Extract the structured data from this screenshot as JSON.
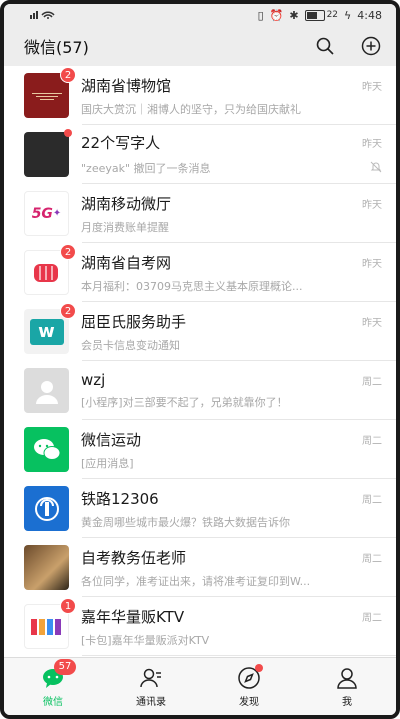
{
  "status_bar": {
    "left_icons": "4G ≋ ⎍",
    "time": "4:48",
    "battery": "22"
  },
  "header": {
    "title": "微信(57)"
  },
  "chats": [
    {
      "name": "湖南省博物馆",
      "time": "昨天",
      "preview": "国庆大赏沉｜湘博人的坚守，只为给国庆献礼",
      "badge": "2"
    },
    {
      "name": "22个写字人",
      "time": "昨天",
      "preview": "\"zeeyak\" 撤回了一条消息",
      "dot": true,
      "muted": true
    },
    {
      "name": "湖南移动微厅",
      "time": "昨天",
      "preview": "月度消费账单提醒"
    },
    {
      "name": "湖南省自考网",
      "time": "昨天",
      "preview": "本月福利：03709马克思主义基本原理概论...",
      "badge": "2"
    },
    {
      "name": "屈臣氏服务助手",
      "time": "昨天",
      "preview": "会员卡信息变动通知",
      "badge": "2"
    },
    {
      "name": "wzj",
      "time": "周二",
      "preview": "[小程序]对三部要不起了，兄弟就靠你了！"
    },
    {
      "name": "微信运动",
      "time": "周二",
      "preview": "[应用消息]"
    },
    {
      "name": "铁路12306",
      "time": "周二",
      "preview": "黄金周哪些城市最火爆？铁路大数据告诉你"
    },
    {
      "name": "自考教务伍老师",
      "time": "周二",
      "preview": "各位同学，准考证出来，请将准考证复印到W..."
    },
    {
      "name": "嘉年华量贩KTV",
      "time": "周二",
      "preview": "[卡包]嘉年华量贩派对KTV",
      "badge": "1"
    }
  ],
  "tabs": [
    {
      "label": "微信",
      "badge": "57"
    },
    {
      "label": "通讯录"
    },
    {
      "label": "发现"
    },
    {
      "label": "我"
    }
  ],
  "colors": {
    "accent": "#07c160",
    "badge": "#f24b4b",
    "header_bg": "#ededed"
  }
}
